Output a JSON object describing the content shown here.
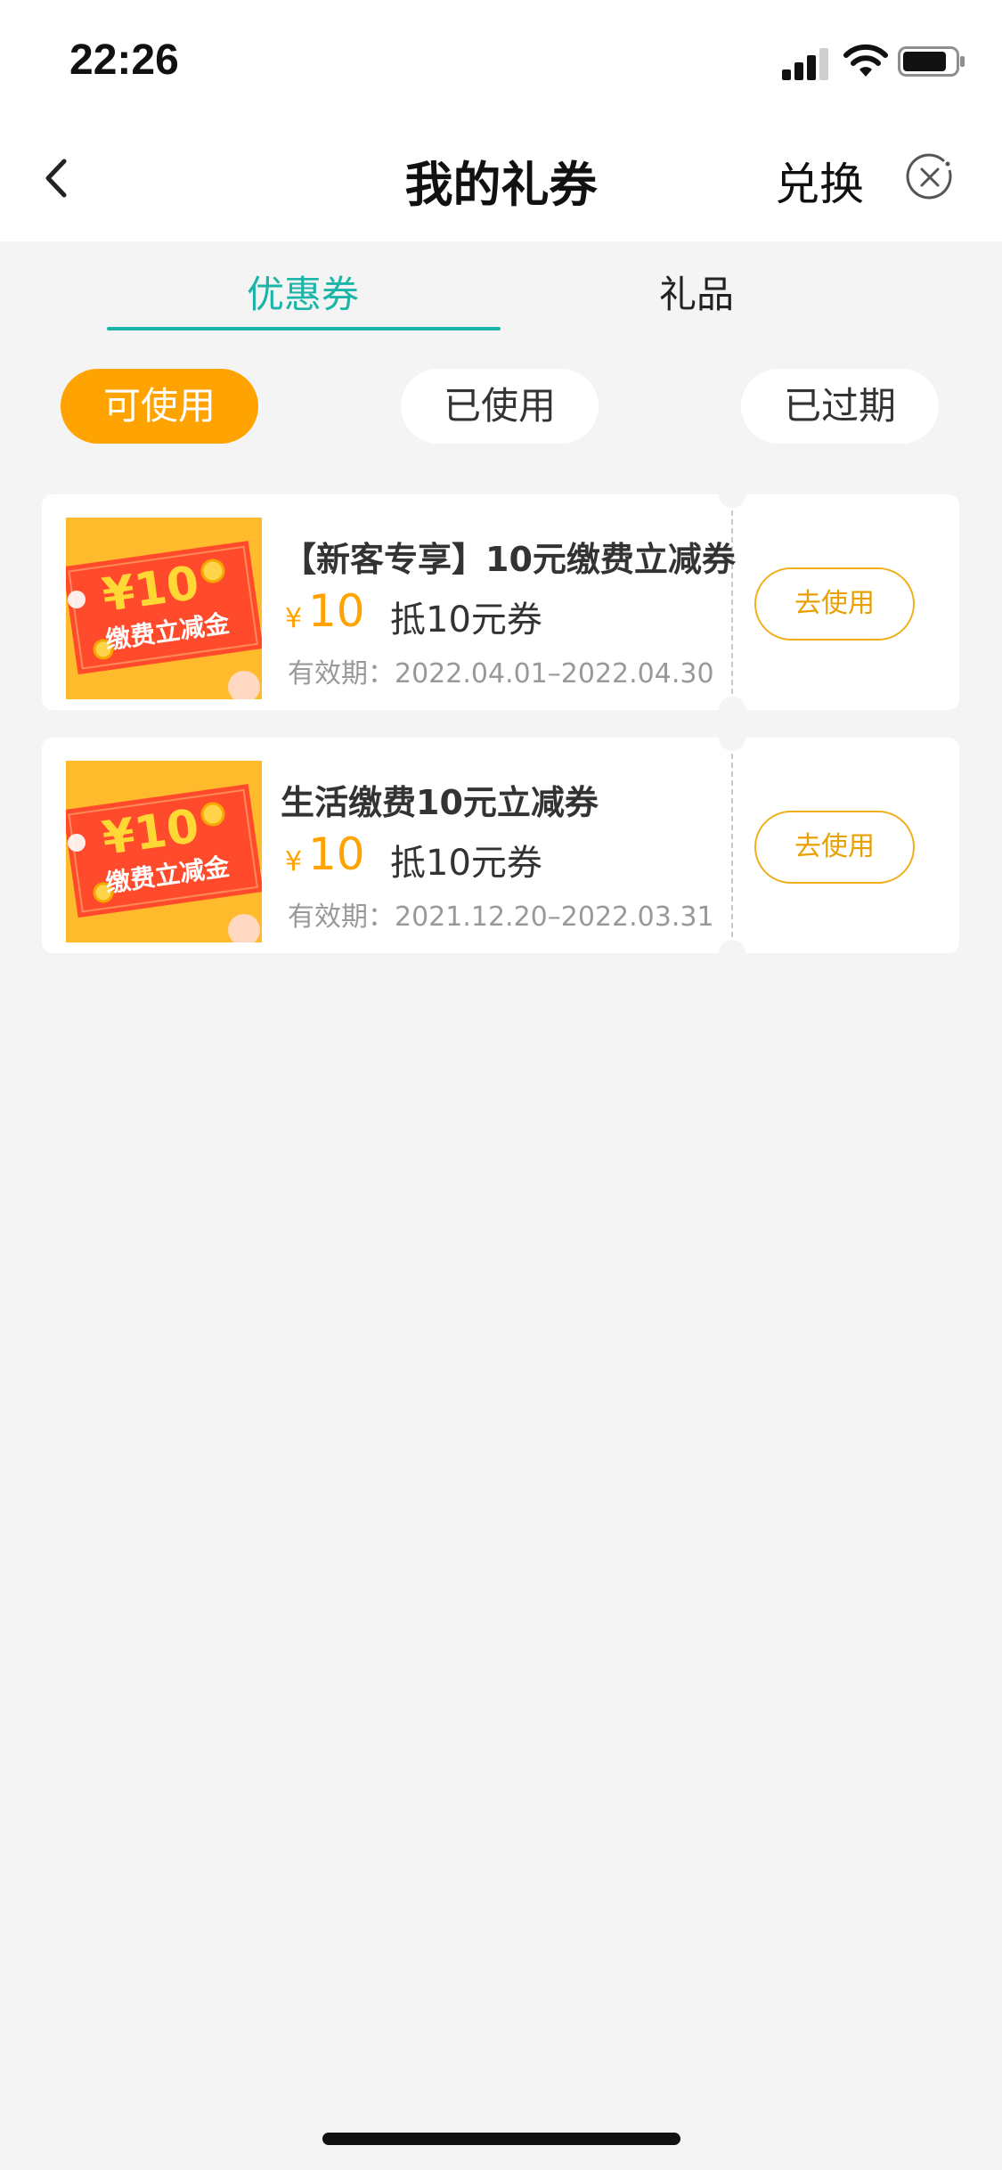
{
  "status_bar": {
    "time": "22:26"
  },
  "nav": {
    "title": "我的礼券",
    "exchange_label": "兑换"
  },
  "tabs": [
    {
      "label": "优惠券",
      "active": true
    },
    {
      "label": "礼品",
      "active": false
    }
  ],
  "filters": [
    {
      "label": "可使用",
      "active": true
    },
    {
      "label": "已使用",
      "active": false
    },
    {
      "label": "已过期",
      "active": false
    }
  ],
  "coupons": [
    {
      "title": "【新客专享】10元缴费立减券",
      "currency": "¥",
      "amount": "10",
      "amount_desc": "抵10元券",
      "validity": "有效期：2022.04.01–2022.04.30",
      "button_label": "去使用",
      "thumb_amount": "¥10",
      "thumb_text": "缴费立减金"
    },
    {
      "title": "生活缴费10元立减券",
      "currency": "¥",
      "amount": "10",
      "amount_desc": "抵10元券",
      "validity": "有效期：2021.12.20–2022.03.31",
      "button_label": "去使用",
      "thumb_amount": "¥10",
      "thumb_text": "缴费立减金"
    }
  ],
  "colors": {
    "accent_teal": "#1bb5a8",
    "accent_orange": "#ffa300",
    "background": "#f4f4f4"
  },
  "icons": {
    "back": "chevron-left-icon",
    "close": "close-circle-icon",
    "signal": "signal-icon",
    "wifi": "wifi-icon",
    "battery": "battery-icon"
  }
}
